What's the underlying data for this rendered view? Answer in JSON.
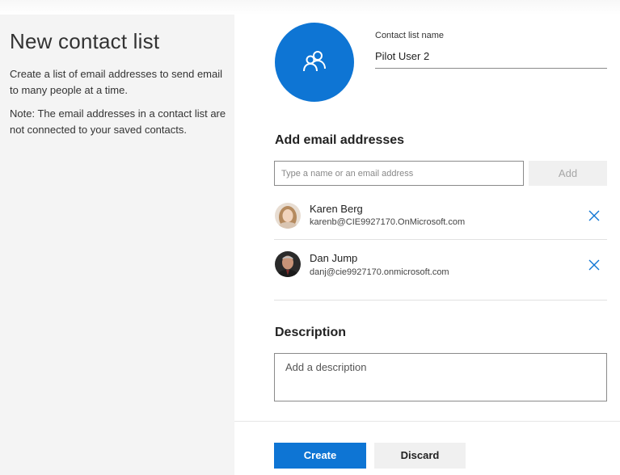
{
  "left_pane": {
    "title": "New contact list",
    "description": "Create a list of email addresses to send email to many people at a time.",
    "note": "Note: The email addresses in a contact list are not connected to your saved contacts."
  },
  "list_name": {
    "label": "Contact list name",
    "value": "Pilot User 2",
    "icon": "people-icon",
    "icon_bg_color": "#0e75d4"
  },
  "add_emails": {
    "heading": "Add email addresses",
    "placeholder": "Type a name or an email address",
    "add_label": "Add"
  },
  "contacts": [
    {
      "name": "Karen Berg",
      "email": "karenb@CIE9927170.OnMicrosoft.com"
    },
    {
      "name": "Dan Jump",
      "email": "danj@cie9927170.onmicrosoft.com"
    }
  ],
  "description": {
    "heading": "Description",
    "placeholder": "Add a description"
  },
  "actions": {
    "create_label": "Create",
    "discard_label": "Discard"
  },
  "colors": {
    "accent": "#0e75d4",
    "left_pane_bg": "#f4f4f4"
  }
}
